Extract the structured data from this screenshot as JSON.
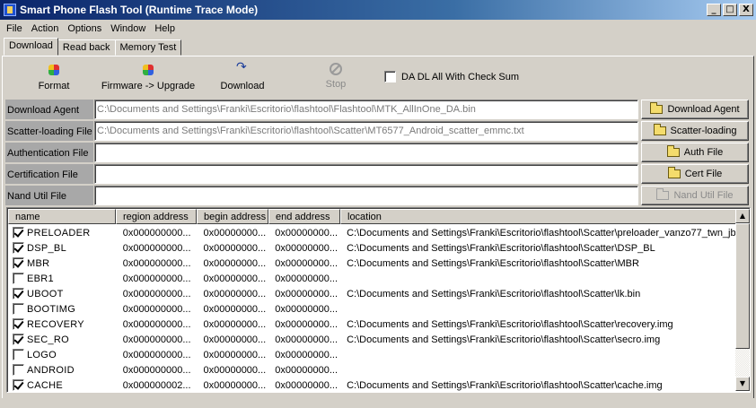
{
  "window": {
    "title": "Smart Phone Flash Tool (Runtime Trace Mode)",
    "buttons": [
      "_",
      "□",
      "X"
    ]
  },
  "menu": [
    "File",
    "Action",
    "Options",
    "Window",
    "Help"
  ],
  "tabs": [
    {
      "label": "Download",
      "active": true
    },
    {
      "label": "Read back",
      "active": false
    },
    {
      "label": "Memory Test",
      "active": false
    }
  ],
  "toolbar": {
    "format": "Format",
    "upgrade": "Firmware -> Upgrade",
    "download": "Download",
    "stop": "Stop",
    "checksum_label": "DA DL All With Check Sum",
    "checksum_checked": false
  },
  "files": [
    {
      "label": "Download Agent",
      "value": "C:\\Documents and Settings\\Franki\\Escritorio\\flashtool\\Flashtool\\MTK_AllInOne_DA.bin",
      "button": "Download Agent",
      "enabled": true
    },
    {
      "label": "Scatter-loading File",
      "value": "C:\\Documents and Settings\\Franki\\Escritorio\\flashtool\\Scatter\\MT6577_Android_scatter_emmc.txt",
      "button": "Scatter-loading",
      "enabled": true
    },
    {
      "label": "Authentication File",
      "value": "",
      "button": "Auth File",
      "enabled": true
    },
    {
      "label": "Certification File",
      "value": "",
      "button": "Cert File",
      "enabled": true
    },
    {
      "label": "Nand Util File",
      "value": "",
      "button": "Nand Util File",
      "enabled": false
    }
  ],
  "table": {
    "columns": [
      "name",
      "region address",
      "begin address",
      "end address",
      "location"
    ],
    "rows": [
      {
        "checked": true,
        "name": "PRELOADER",
        "region": "0x000000000...",
        "begin": "0x00000000...",
        "end": "0x00000000...",
        "location": "C:\\Documents and Settings\\Franki\\Escritorio\\flashtool\\Scatter\\preloader_vanzo77_twn_jb.b"
      },
      {
        "checked": true,
        "name": "DSP_BL",
        "region": "0x000000000...",
        "begin": "0x00000000...",
        "end": "0x00000000...",
        "location": "C:\\Documents and Settings\\Franki\\Escritorio\\flashtool\\Scatter\\DSP_BL"
      },
      {
        "checked": true,
        "name": "MBR",
        "region": "0x000000000...",
        "begin": "0x00000000...",
        "end": "0x00000000...",
        "location": "C:\\Documents and Settings\\Franki\\Escritorio\\flashtool\\Scatter\\MBR"
      },
      {
        "checked": false,
        "name": "EBR1",
        "region": "0x000000000...",
        "begin": "0x00000000...",
        "end": "0x00000000...",
        "location": ""
      },
      {
        "checked": true,
        "name": "UBOOT",
        "region": "0x000000000...",
        "begin": "0x00000000...",
        "end": "0x00000000...",
        "location": "C:\\Documents and Settings\\Franki\\Escritorio\\flashtool\\Scatter\\lk.bin"
      },
      {
        "checked": false,
        "name": "BOOTIMG",
        "region": "0x000000000...",
        "begin": "0x00000000...",
        "end": "0x00000000...",
        "location": ""
      },
      {
        "checked": true,
        "name": "RECOVERY",
        "region": "0x000000000...",
        "begin": "0x00000000...",
        "end": "0x00000000...",
        "location": "C:\\Documents and Settings\\Franki\\Escritorio\\flashtool\\Scatter\\recovery.img"
      },
      {
        "checked": true,
        "name": "SEC_RO",
        "region": "0x000000000...",
        "begin": "0x00000000...",
        "end": "0x00000000...",
        "location": "C:\\Documents and Settings\\Franki\\Escritorio\\flashtool\\Scatter\\secro.img"
      },
      {
        "checked": false,
        "name": "LOGO",
        "region": "0x000000000...",
        "begin": "0x00000000...",
        "end": "0x00000000...",
        "location": ""
      },
      {
        "checked": false,
        "name": "ANDROID",
        "region": "0x000000000...",
        "begin": "0x00000000...",
        "end": "0x00000000...",
        "location": ""
      },
      {
        "checked": true,
        "name": "CACHE",
        "region": "0x000000002...",
        "begin": "0x00000000...",
        "end": "0x00000000...",
        "location": "C:\\Documents and Settings\\Franki\\Escritorio\\flashtool\\Scatter\\cache.img"
      }
    ]
  },
  "icons": {
    "format": "format-icon",
    "upgrade": "firmware-upgrade-icon",
    "download": "download-icon",
    "stop": "stop-icon",
    "folder": "folder-icon"
  },
  "colors": {
    "title_gradient_start": "#0a246a",
    "title_gradient_end": "#a6caf0",
    "face": "#d4d0c8",
    "label_bg": "#a8a8a8"
  }
}
